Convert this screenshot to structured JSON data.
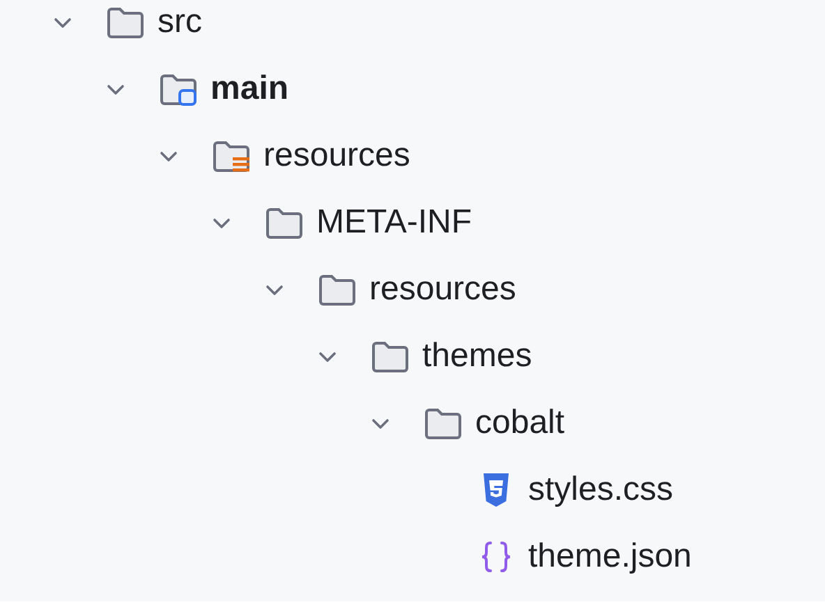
{
  "tree": [
    {
      "label": "src",
      "kind": "folder",
      "expanded": true,
      "children": [
        {
          "label": "main",
          "kind": "source-folder",
          "bold": true,
          "expanded": true,
          "children": [
            {
              "label": "resources",
              "kind": "resources-folder",
              "expanded": true,
              "children": [
                {
                  "label": "META-INF",
                  "kind": "folder",
                  "expanded": true,
                  "children": [
                    {
                      "label": "resources",
                      "kind": "folder",
                      "expanded": true,
                      "children": [
                        {
                          "label": "themes",
                          "kind": "folder",
                          "expanded": true,
                          "children": [
                            {
                              "label": "cobalt",
                              "kind": "folder",
                              "expanded": true,
                              "children": [
                                {
                                  "label": "styles.css",
                                  "kind": "css"
                                },
                                {
                                  "label": "theme.json",
                                  "kind": "json"
                                }
                              ]
                            }
                          ]
                        }
                      ]
                    }
                  ]
                }
              ]
            }
          ]
        }
      ]
    }
  ]
}
